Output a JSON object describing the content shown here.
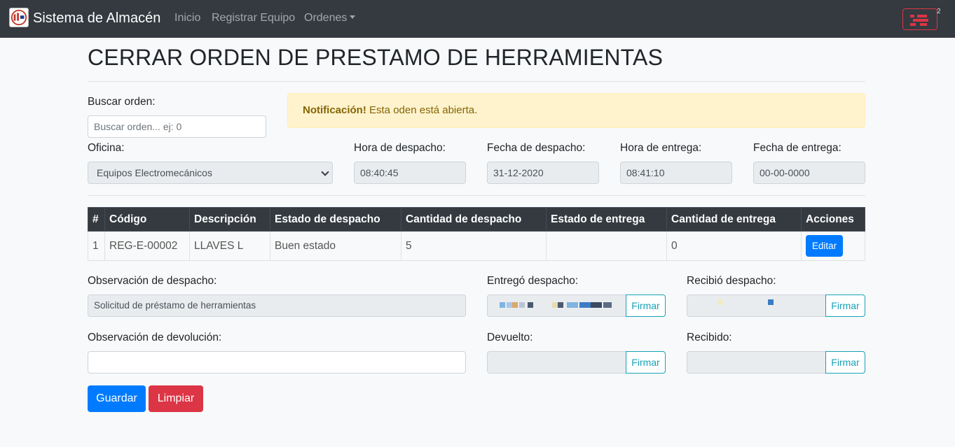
{
  "navbar": {
    "brand": "Sistema de Almacén",
    "links": [
      "Inicio",
      "Registrar Equipo",
      "Ordenes"
    ],
    "user_badge": "2"
  },
  "page": {
    "title": "CERRAR ORDEN DE PRESTAMO DE HERRAMIENTAS"
  },
  "search": {
    "label": "Buscar orden:",
    "placeholder": "Buscar orden... ej: 0"
  },
  "alert": {
    "strong": "Notificación!",
    "text": " Esta oden está abierta."
  },
  "form": {
    "oficina_label": "Oficina:",
    "oficina_value": "Equipos Electromecánicos",
    "hora_despacho_label": "Hora de despacho:",
    "hora_despacho_value": "08:40:45",
    "fecha_despacho_label": "Fecha de despacho:",
    "fecha_despacho_value": "31-12-2020",
    "hora_entrega_label": "Hora de entrega:",
    "hora_entrega_value": "08:41:10",
    "fecha_entrega_label": "Fecha de entrega:",
    "fecha_entrega_value": "00-00-0000"
  },
  "table": {
    "headers": [
      "#",
      "Código",
      "Descripción",
      "Estado de despacho",
      "Cantidad de despacho",
      "Estado de entrega",
      "Cantidad de entrega",
      "Acciones"
    ],
    "rows": [
      {
        "num": "1",
        "codigo": "REG-E-00002",
        "descripcion": "LLAVES L",
        "estado_despacho": "Buen estado",
        "cantidad_despacho": "5",
        "estado_entrega": "",
        "cantidad_entrega": "0",
        "action": "Editar"
      }
    ]
  },
  "observations": {
    "despacho_label": "Observación de despacho:",
    "despacho_value": "Solicitud de préstamo de herramientas",
    "devolucion_label": "Observación de devolución:",
    "devolucion_value": ""
  },
  "signatures": {
    "entrego_label": "Entregó despacho:",
    "recibio_label": "Recibió despacho:",
    "devuelto_label": "Devuelto:",
    "recibido_label": "Recibido:",
    "firmar": "Firmar"
  },
  "actions": {
    "guardar": "Guardar",
    "limpiar": "Limpiar"
  },
  "colors": {
    "navbar": "#343a40",
    "primary": "#007bff",
    "danger": "#dc3545",
    "info": "#17a2b8",
    "warning_bg": "#fff3cd",
    "warning_text": "#856404"
  }
}
